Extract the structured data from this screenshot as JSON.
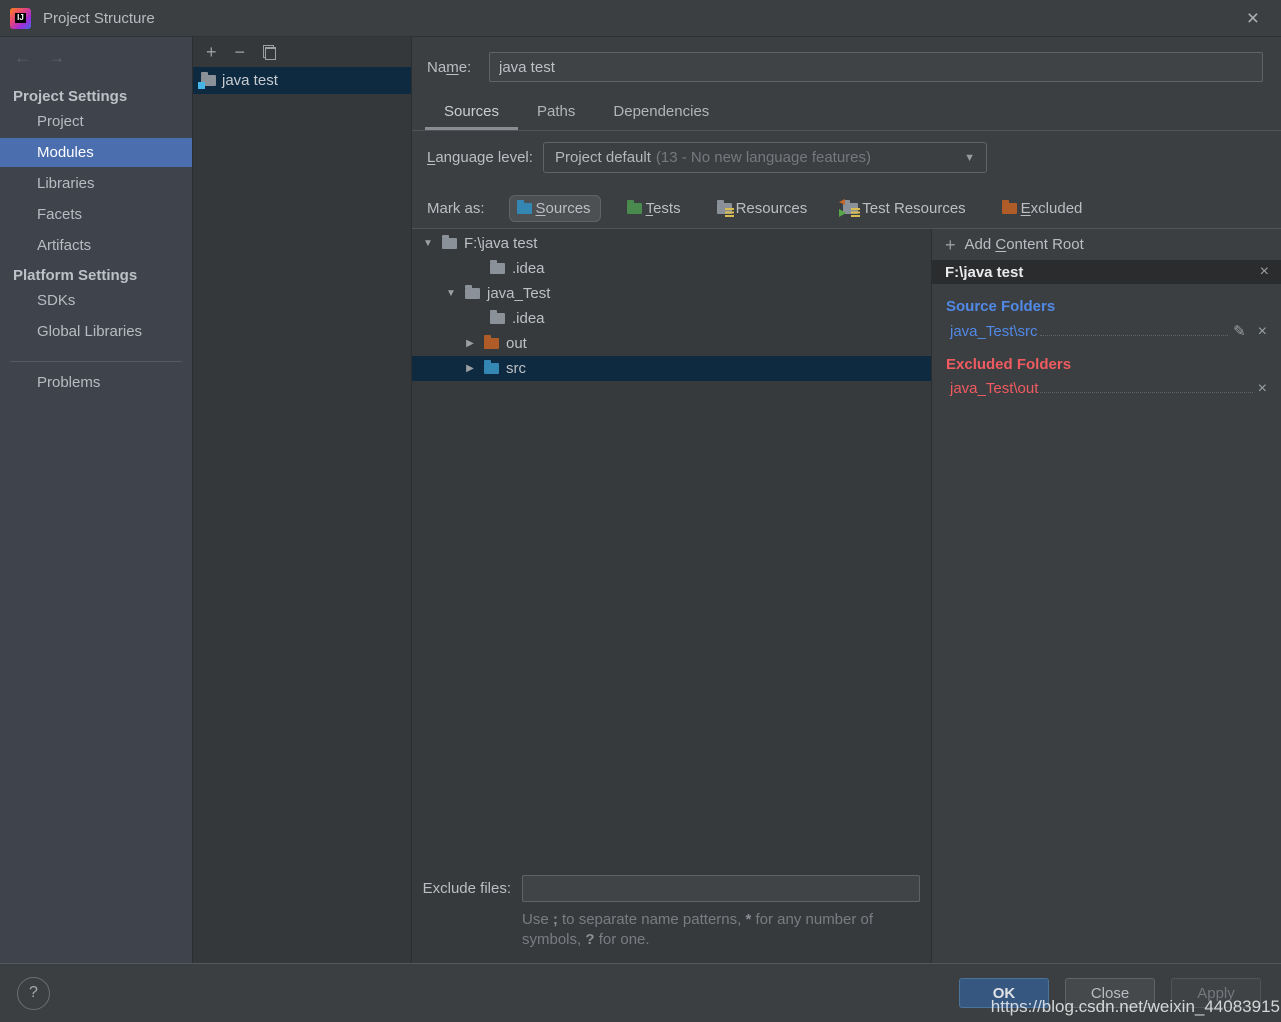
{
  "colors": {
    "titlebar_bg": "#3c3f41",
    "sidebar_bg": "#3e434c",
    "sidebar_selection": "#4b6eaf",
    "panel_bg": "#35383a",
    "tree_selection": "#0d2a40",
    "source_blue": "#5189e6",
    "excluded_red": "#ef5b60",
    "folder_gray": "#8a9199",
    "folder_blue": "#3487b2",
    "folder_green": "#4a8a4e",
    "folder_orange": "#b05c28",
    "ok_button_bg": "#365880"
  },
  "window": {
    "app_icon": "IJ",
    "title": "Project Structure",
    "close_icon": "×"
  },
  "sidebar": {
    "back_icon": "←",
    "forward_icon": "→",
    "group1_label": "Project Settings",
    "group1_items": [
      "Project",
      "Modules",
      "Libraries",
      "Facets",
      "Artifacts"
    ],
    "selected_item": "Modules",
    "group2_label": "Platform Settings",
    "group2_items": [
      "SDKs",
      "Global Libraries"
    ],
    "bottom_item": "Problems"
  },
  "modules_panel": {
    "add_icon": "+",
    "remove_icon": "−",
    "copy_icon": "copy",
    "items": [
      {
        "label": "java test",
        "selected": true
      }
    ]
  },
  "form": {
    "name": {
      "label": {
        "pre": "Na",
        "mn": "m",
        "post": "e:"
      },
      "value": "java test"
    },
    "tabs": [
      {
        "label": "Sources",
        "selected": true
      },
      {
        "label": "Paths",
        "selected": false
      },
      {
        "label": "Dependencies",
        "selected": false
      }
    ],
    "language_level": {
      "label": {
        "pre": "",
        "mn": "L",
        "post": "anguage level:"
      },
      "value": "Project default",
      "hint": "(13 - No new language features)",
      "arrow": "▼"
    },
    "mark_as_label": "Mark as:",
    "mark_buttons": [
      {
        "pre": "",
        "mn": "S",
        "post": "ources",
        "icon": "sources-folder",
        "selected": true
      },
      {
        "pre": "",
        "mn": "T",
        "post": "ests",
        "icon": "tests-folder",
        "selected": false
      },
      {
        "pre": "Resources",
        "mn": "",
        "post": "",
        "icon": "resources-folder",
        "selected": false
      },
      {
        "pre": "Test Resources",
        "mn": "",
        "post": "",
        "icon": "test-resources-folder",
        "selected": false
      },
      {
        "pre": "",
        "mn": "E",
        "post": "xcluded",
        "icon": "excluded-folder",
        "selected": false
      }
    ]
  },
  "tree": {
    "rows": [
      {
        "arrow": "▼",
        "label": "F:\\java test",
        "folder": "gray",
        "selected": false
      },
      {
        "arrow": "",
        "label": ".idea",
        "folder": "gray",
        "selected": false
      },
      {
        "arrow": "▼",
        "label": "java_Test",
        "folder": "gray",
        "selected": false
      },
      {
        "arrow": "",
        "label": ".idea",
        "folder": "gray",
        "selected": false
      },
      {
        "arrow": "▶",
        "label": "out",
        "folder": "orange",
        "selected": false
      },
      {
        "arrow": "▶",
        "label": "src",
        "folder": "blue",
        "selected": true
      }
    ]
  },
  "content_root": {
    "add_icon": "+",
    "add_label": {
      "pre": "Add ",
      "mn": "C",
      "post": "ontent Root"
    },
    "root_path": "F:\\java test",
    "root_close_icon": "×",
    "source_folders_label": "Source Folders",
    "source_folder": {
      "path": "java_Test\\src",
      "edit_icon": "✎",
      "remove_icon": "×"
    },
    "excluded_folders_label": "Excluded Folders",
    "excluded_folder": {
      "path": "java_Test\\out",
      "remove_icon": "×"
    }
  },
  "exclude_files": {
    "label": "Exclude files:",
    "value": "",
    "hint": {
      "p1": "Use ",
      "b1": ";",
      "p2": " to separate name patterns, ",
      "b2": "*",
      "p3": " for any number of symbols, ",
      "b3": "?",
      "p4": " for one."
    }
  },
  "footer": {
    "help_icon": "?",
    "ok_label": "OK",
    "close_label": "Close",
    "apply_label": "Apply"
  },
  "watermark": "https://blog.csdn.net/weixin_44083915"
}
